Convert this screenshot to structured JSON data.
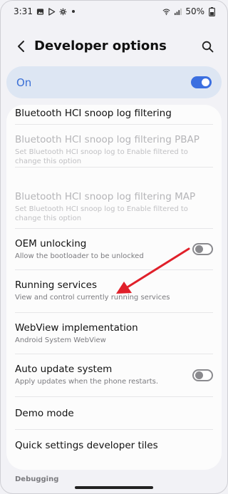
{
  "status_bar": {
    "time": "3:31",
    "battery": "50%",
    "icons": [
      "gallery-icon",
      "play-store-icon",
      "settings-icon",
      "wifi-icon",
      "signal-icon",
      "battery-icon"
    ]
  },
  "header": {
    "title": "Developer options",
    "back_icon": "chevron-left-icon",
    "search_icon": "search-icon"
  },
  "master_switch": {
    "label": "On",
    "state": "on"
  },
  "items": [
    {
      "title": "Bluetooth HCI snoop log filtering",
      "subtitle": "",
      "enabled": true,
      "toggle": null
    },
    {
      "title": "Bluetooth HCI snoop log filtering PBAP",
      "subtitle": "Set Bluetooth HCI snoop log to Enable filtered to change this option",
      "enabled": false,
      "toggle": null
    },
    {
      "title": "Bluetooth HCI snoop log filtering MAP",
      "subtitle": "Set Bluetooth HCI snoop log to Enable filtered to change this option",
      "enabled": false,
      "toggle": null
    },
    {
      "title": "OEM unlocking",
      "subtitle": "Allow the bootloader to be unlocked",
      "enabled": true,
      "toggle": "off"
    },
    {
      "title": "Running services",
      "subtitle": "View and control currently running services",
      "enabled": true,
      "toggle": null
    },
    {
      "title": "WebView implementation",
      "subtitle": "Android System WebView",
      "enabled": true,
      "toggle": null
    },
    {
      "title": "Auto update system",
      "subtitle": "Apply updates when the phone restarts.",
      "enabled": true,
      "toggle": "off"
    },
    {
      "title": "Demo mode",
      "subtitle": "",
      "enabled": true,
      "toggle": null
    },
    {
      "title": "Quick settings developer tiles",
      "subtitle": "",
      "enabled": true,
      "toggle": null
    }
  ],
  "next_section": "Debugging",
  "colors": {
    "accent": "#3b6fe0",
    "master_bg": "#dde6f3",
    "annotation_arrow": "#e0202a"
  }
}
